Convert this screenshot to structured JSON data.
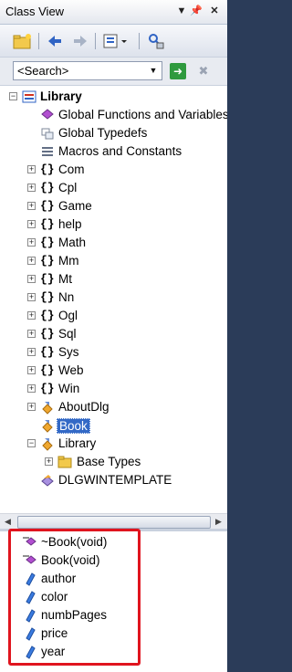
{
  "window": {
    "title": "Class View"
  },
  "search": {
    "value": "<Search>"
  },
  "tree": {
    "root": "Library",
    "items": [
      {
        "label": "Global Functions and Variables"
      },
      {
        "label": "Global Typedefs"
      },
      {
        "label": "Macros and Constants"
      },
      {
        "label": "Com"
      },
      {
        "label": "Cpl"
      },
      {
        "label": "Game"
      },
      {
        "label": "help"
      },
      {
        "label": "Math"
      },
      {
        "label": "Mm"
      },
      {
        "label": "Mt"
      },
      {
        "label": "Nn"
      },
      {
        "label": "Ogl"
      },
      {
        "label": "Sql"
      },
      {
        "label": "Sys"
      },
      {
        "label": "Web"
      },
      {
        "label": "Win"
      },
      {
        "label": "AboutDlg"
      },
      {
        "label": "Book"
      },
      {
        "label": "Library"
      },
      {
        "label": "Base Types"
      },
      {
        "label": "DLGWINTEMPLATE"
      }
    ]
  },
  "members": {
    "items": [
      {
        "label": "~Book(void)"
      },
      {
        "label": "Book(void)"
      },
      {
        "label": "author"
      },
      {
        "label": "color"
      },
      {
        "label": "numbPages"
      },
      {
        "label": "price"
      },
      {
        "label": "year"
      }
    ]
  },
  "colors": {
    "selection": "#3369c6",
    "highlight_box": "#e0141e"
  }
}
